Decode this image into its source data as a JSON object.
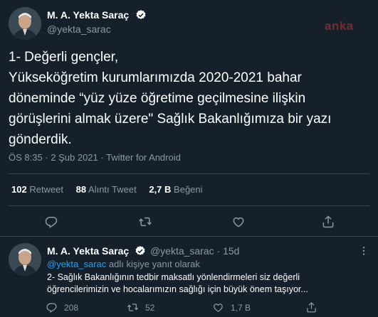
{
  "main_tweet": {
    "author_name": "M. A. Yekta Saraç",
    "handle": "@yekta_sarac",
    "text_lines": [
      "1- Değerli gençler,",
      "Yükseköğretim kurumlarımızda 2020-2021 bahar",
      "döneminde “yüz yüze öğretime geçilmesine ilişkin",
      "görüşlerini almak üzere\" Sağlık Bakanlığımıza bir yazı",
      "gönderdik."
    ],
    "meta": "ÖS 8:35 · 2 Şub 2021 · Twitter for Android",
    "stats": {
      "retweets_num": "102",
      "retweets_label": "Retweet",
      "quotes_num": "88",
      "quotes_label": "Alıntı Tweet",
      "likes_num": "2,7 B",
      "likes_label": "Beğeni"
    }
  },
  "watermark": "anka",
  "reply": {
    "author_name": "M. A. Yekta Saraç",
    "handle_time": "@yekta_sarac · 15d",
    "replying_handle": "@yekta_sarac",
    "replying_suffix": "adlı kişiye yanıt olarak",
    "text_lines": [
      "2- Sağlık Bakanlığının tedbir maksatlı yönlendirmeleri siz değerli",
      "öğrencilerimizin ve hocalarımızın sağlığı için büyük önem taşıyor..."
    ],
    "reply_count": "208",
    "retweet_count": "52",
    "like_count": "1,7 B"
  },
  "colors": {
    "background": "#15202b",
    "accent": "#1da1f2",
    "muted": "#8899a6",
    "divider": "#38444d"
  },
  "icons": [
    "verified-badge-icon",
    "reply-icon",
    "retweet-icon",
    "like-icon",
    "share-icon"
  ]
}
